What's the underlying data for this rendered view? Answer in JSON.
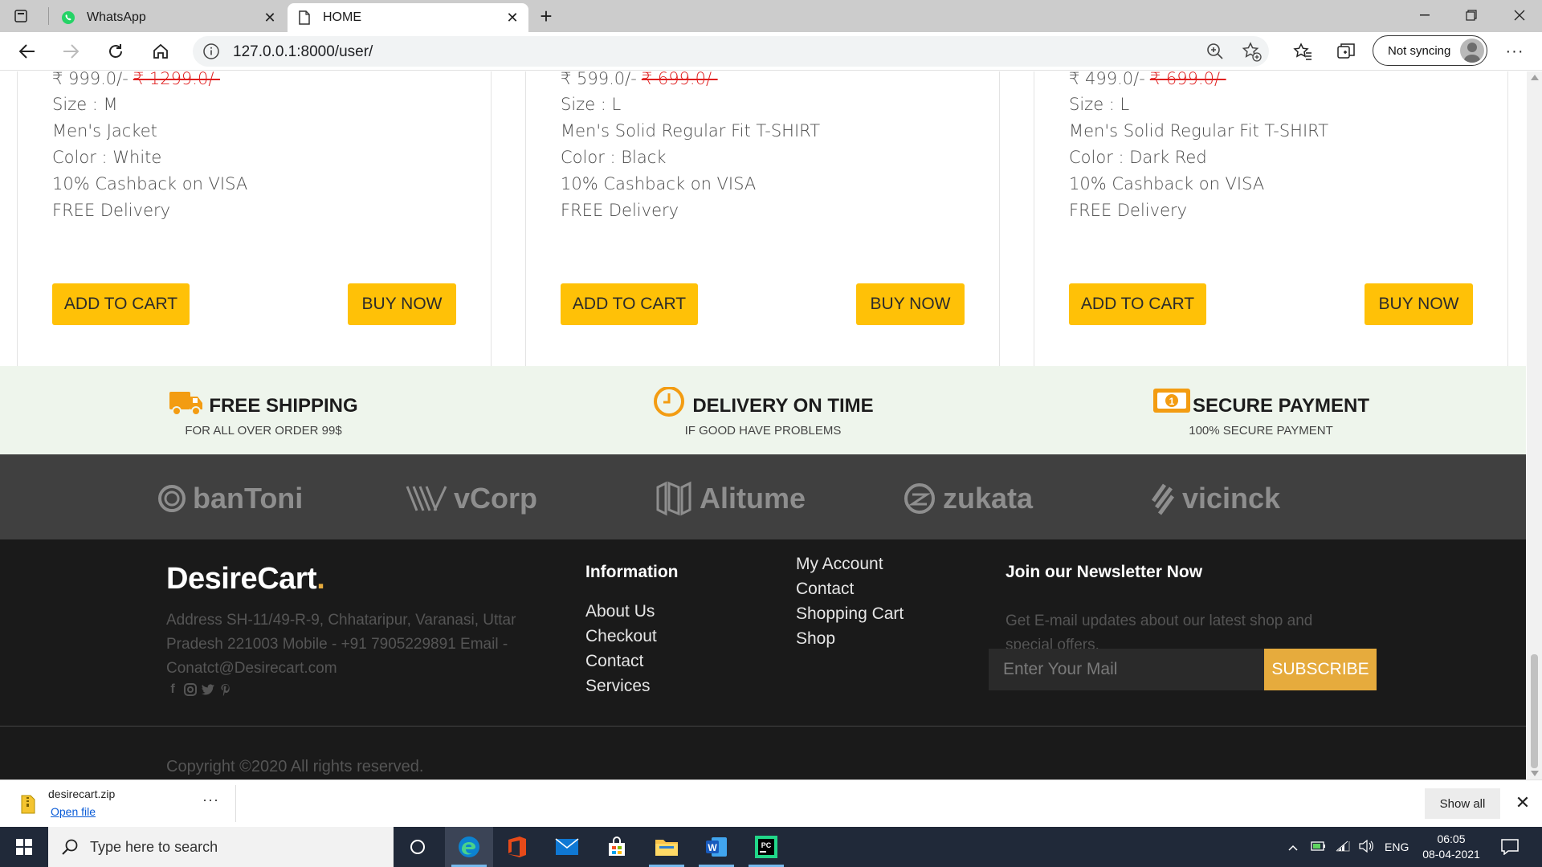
{
  "browser": {
    "tabs": [
      {
        "label": "WhatsApp",
        "active": false,
        "icon": "whatsapp-icon"
      },
      {
        "label": "HOME",
        "active": true,
        "icon": "page-icon"
      }
    ],
    "url": "127.0.0.1:8000/user/",
    "sync_label": "Not syncing"
  },
  "products": [
    {
      "price": "₹ 999.0/-",
      "old_price": "₹ 1299.0/-",
      "size": "Size : M",
      "name": "Men's Jacket",
      "color": "Color : White",
      "offer": "10% Cashback on VISA",
      "delivery": "FREE Delivery"
    },
    {
      "price": "₹ 599.0/-",
      "old_price": "₹ 699.0/-",
      "size": "Size : L",
      "name": "Men's Solid Regular Fit T-SHIRT",
      "color": "Color : Black",
      "offer": "10% Cashback on VISA",
      "delivery": "FREE Delivery"
    },
    {
      "price": "₹ 499.0/-",
      "old_price": "₹ 699.0/-",
      "size": "Size : L",
      "name": "Men's Solid Regular Fit T-SHIRT",
      "color": "Color : Dark Red",
      "offer": "10% Cashback on VISA",
      "delivery": "FREE Delivery"
    }
  ],
  "buttons": {
    "add_to_cart": "ADD TO CART",
    "buy_now": "BUY NOW"
  },
  "features": [
    {
      "title": "FREE SHIPPING",
      "subtitle": "FOR ALL OVER ORDER 99$",
      "icon": "truck-icon"
    },
    {
      "title": "DELIVERY ON TIME",
      "subtitle": "IF GOOD HAVE PROBLEMS",
      "icon": "clock-icon"
    },
    {
      "title": "SECURE PAYMENT",
      "subtitle": "100% SECURE PAYMENT",
      "icon": "money-icon"
    }
  ],
  "brands": [
    "banToni",
    "vCorp",
    "Alitume",
    "zukata",
    "vicinck"
  ],
  "footer": {
    "logo": "DesireCart",
    "logo_dot": ".",
    "address": "Address SH-11/49-R-9, Chhataripur, Varanasi, Uttar Pradesh 221003 Mobile - +91 7905229891 Email - Conatct@Desirecart.com",
    "information_heading": "Information",
    "information_links": [
      "About Us",
      "Checkout",
      "Contact",
      "Services"
    ],
    "account_links": [
      "My Account",
      "Contact",
      "Shopping Cart",
      "Shop"
    ],
    "newsletter_heading": "Join our Newsletter Now",
    "newsletter_desc": "Get E-mail updates about our latest shop and special offers.",
    "newsletter_placeholder": "Enter Your Mail",
    "subscribe_label": "SUBSCRIBE",
    "copyright": "Copyright ©2020 All rights reserved."
  },
  "download": {
    "filename": "desirecart.zip",
    "open_label": "Open file",
    "show_all": "Show all"
  },
  "taskbar": {
    "search_placeholder": "Type here to search",
    "lang": "ENG",
    "time": "06:05",
    "date": "08-04-2021"
  },
  "colors": {
    "accent": "#ffc107",
    "brand_dot": "#e6ab3d",
    "price_old": "#e02020",
    "features_bg": "#eef5ec",
    "footer_bg": "#1a1a1a"
  }
}
